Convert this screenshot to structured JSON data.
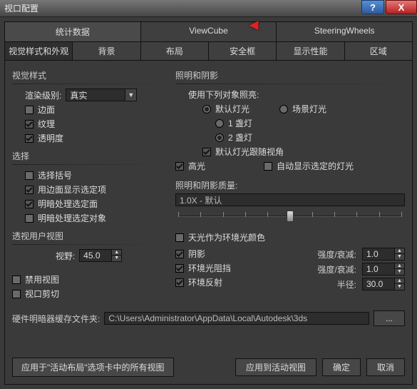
{
  "window": {
    "title": "视口配置",
    "help": "?",
    "close": "X"
  },
  "tabs_main": [
    "统计数据",
    "ViewCube",
    "SteeringWheels"
  ],
  "tabs_sub": [
    "视觉样式和外观",
    "背景",
    "布局",
    "安全框",
    "显示性能",
    "区域"
  ],
  "visual_style": {
    "title": "视觉样式",
    "render_level_label": "渲染级别:",
    "render_level_value": "真实",
    "edged": "边面",
    "texture": "纹理",
    "transparency": "透明度"
  },
  "selection": {
    "title": "选择",
    "bracket": "选择括号",
    "edge_faces": "用边面显示选定项",
    "shade_sel": "明暗处理选定面",
    "shade_sel_obj": "明暗处理选定对象"
  },
  "persp": {
    "title": "透视用户视图",
    "fov_label": "视野:",
    "fov_value": "45.0"
  },
  "misc": {
    "disable_view": "禁用视图",
    "viewport_clip": "视口剪切"
  },
  "lighting": {
    "title": "照明和阴影",
    "use_label": "使用下列对象照亮:",
    "default_light": "默认灯光",
    "scene_light": "场景灯光",
    "one_lamp": "1 盏灯",
    "two_lamp": "2 盏灯",
    "follow": "默认灯光跟随视角",
    "highlight": "高光",
    "auto_show": "自动显示选定的灯光",
    "quality_title": "照明和阴影质量:",
    "quality_value": "1.0X - 默认",
    "skylight": "天光作为环境光颜色",
    "shadow": "阴影",
    "ao": "环境光阻挡",
    "reflect": "环境反射",
    "intensity": "强度/衰减:",
    "radius": "半径:",
    "int1": "1.0",
    "int2": "1.0",
    "rad": "30.0"
  },
  "hw": {
    "label": "硬件明暗器缓存文件夹:",
    "path": "C:\\Users\\Administrator\\AppData\\Local\\Autodesk\\3ds",
    "browse": "..."
  },
  "buttons": {
    "apply_all": "应用于\"活动布局\"选项卡中的所有视图",
    "apply_active": "应用到活动视图",
    "ok": "确定",
    "cancel": "取消"
  }
}
